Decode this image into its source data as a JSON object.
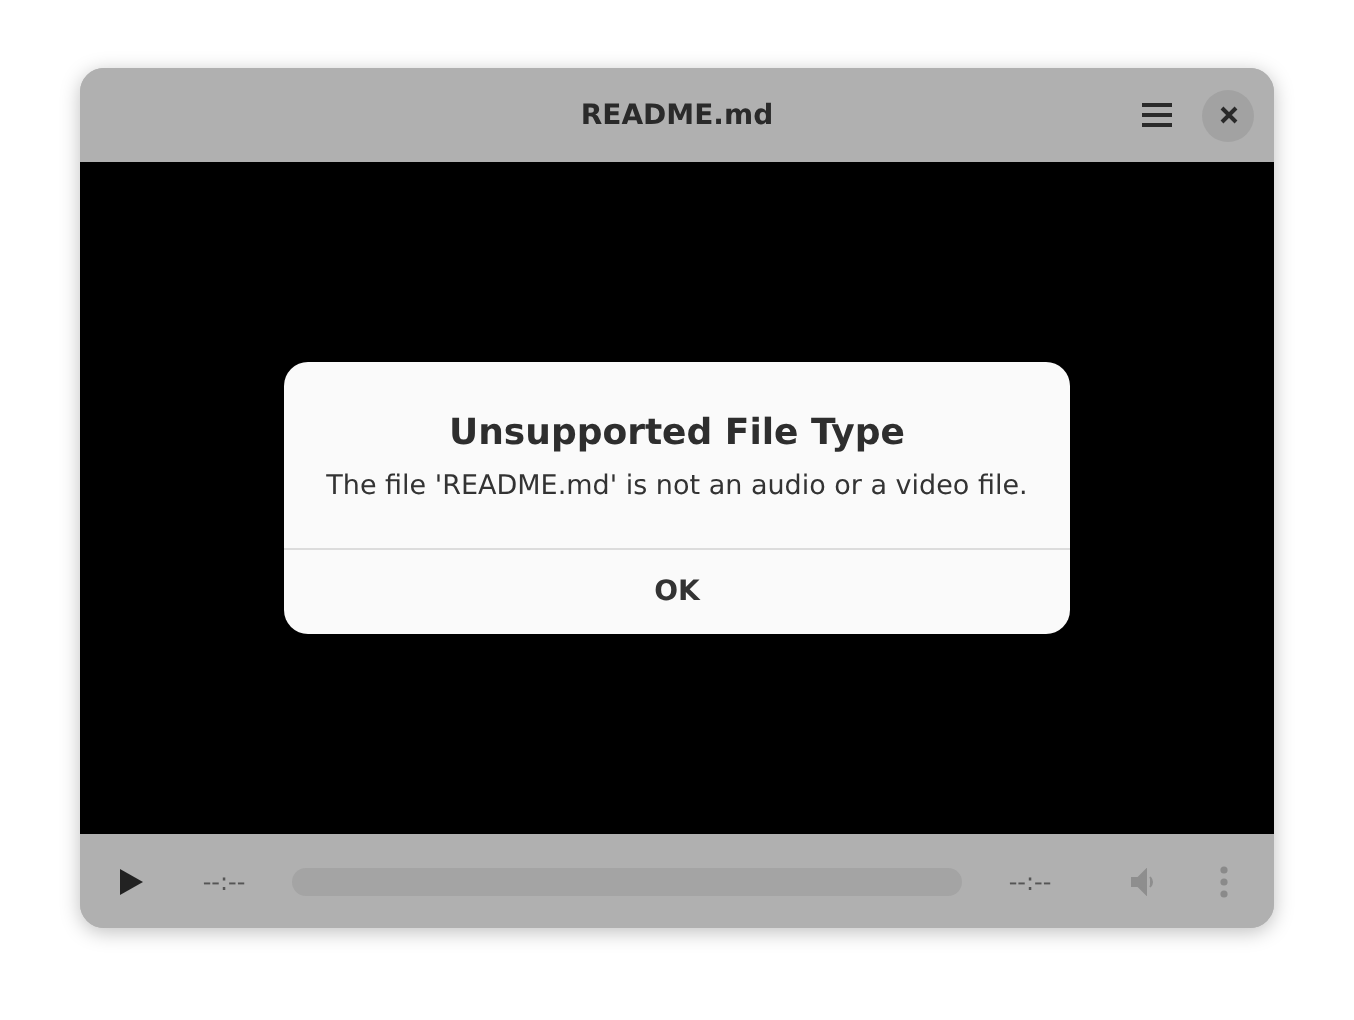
{
  "window": {
    "title": "README.md"
  },
  "dialog": {
    "title": "Unsupported File Type",
    "message": "The file 'README.md' is not an audio or a video file.",
    "button": "OK"
  },
  "controls": {
    "elapsed": "--:--",
    "remaining": "--:--"
  }
}
